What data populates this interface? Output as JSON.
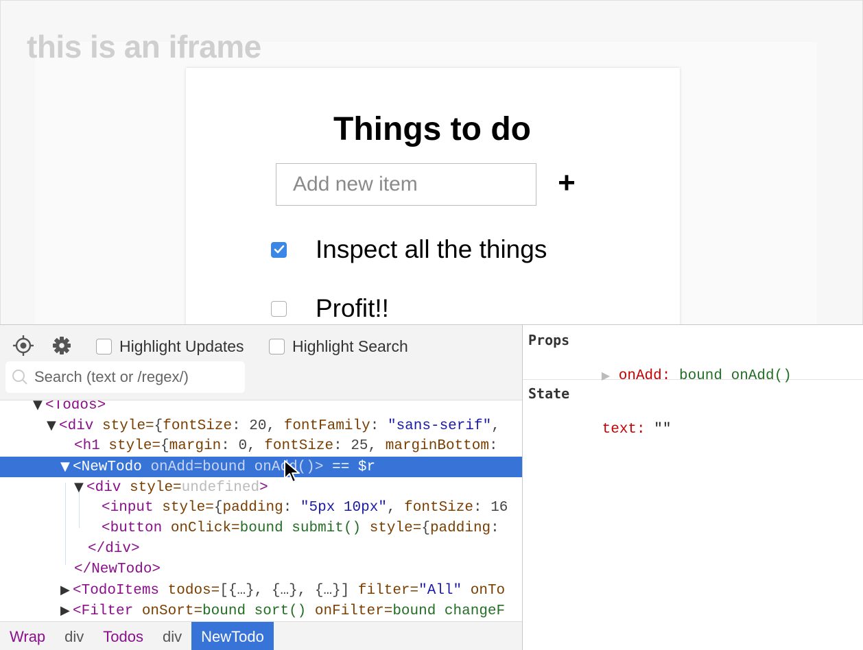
{
  "iframe": {
    "label": "this is an iframe",
    "title": "Things to do",
    "input_placeholder": "Add new item",
    "add_button": "+",
    "todos": [
      {
        "text": "Inspect all the things",
        "checked": true
      },
      {
        "text": "Profit!!",
        "checked": false
      }
    ]
  },
  "toolbar": {
    "highlight_updates": "Highlight Updates",
    "highlight_search": "Highlight Search",
    "search_placeholder": "Search (text or /regex/)"
  },
  "tree": {
    "todos_open": "<Todos>",
    "div_tag": "<div",
    "div_style_attr": "style=",
    "div_style_p1": "{",
    "div_style_k1": "fontSize",
    "div_style_v1": ": 20, ",
    "div_style_k2": "fontFamily",
    "div_style_v2": ": ",
    "div_style_s2": "\"sans-serif\"",
    "div_style_tail": ",",
    "h1_tag": "<h1",
    "h1_attr": "style=",
    "h1_p1": "{",
    "h1_k1": "margin",
    "h1_v1": ": 0, ",
    "h1_k2": "fontSize",
    "h1_v2": ": 25, ",
    "h1_k3": "marginBottom",
    "h1_v3": ":",
    "newtodo_tag": "<NewTodo",
    "newtodo_attr": "onAdd=",
    "newtodo_fn": "bound onAdd()",
    "newtodo_close": ">",
    "newtodo_ref": " == $r",
    "inner_div_tag": "<div",
    "inner_div_attr": "style=",
    "inner_div_val": "undefined",
    "inner_div_close": ">",
    "input_tag": "<input",
    "input_attr": "style=",
    "input_p1": "{",
    "input_k1": "padding",
    "input_v1": ": ",
    "input_s1": "\"5px 10px\"",
    "input_v1b": ", ",
    "input_k2": "fontSize",
    "input_v2": ": 16",
    "button_tag": "<button",
    "button_attr1": "onClick=",
    "button_fn": "bound submit()",
    "button_attr2": "style=",
    "button_p": "{",
    "button_k1": "padding",
    "button_v1": ":",
    "div_close": "</div>",
    "newtodo_end": "</NewTodo>",
    "todoitems_tag": "<TodoItems",
    "todoitems_attr1": "todos=",
    "todoitems_val1": "[{…}, {…}, {…}]",
    "todoitems_attr2": "filter=",
    "todoitems_str": "\"All\"",
    "todoitems_attr3": "onTo",
    "filter_tag": "<Filter",
    "filter_attr1": "onSort=",
    "filter_fn1": "bound sort()",
    "filter_attr2": "onFilter=",
    "filter_fn2": "bound changeF"
  },
  "breadcrumb": [
    "Wrap",
    "div",
    "Todos",
    "div",
    "NewTodo"
  ],
  "props": {
    "title": "Props",
    "key": "onAdd",
    "value": "bound onAdd()"
  },
  "state": {
    "title": "State",
    "key": "text",
    "value": "\"\""
  },
  "colors": {
    "selection": "#3874d8",
    "checkbox_checked": "#3b87e8",
    "component_tag": "#8b0f8b"
  }
}
